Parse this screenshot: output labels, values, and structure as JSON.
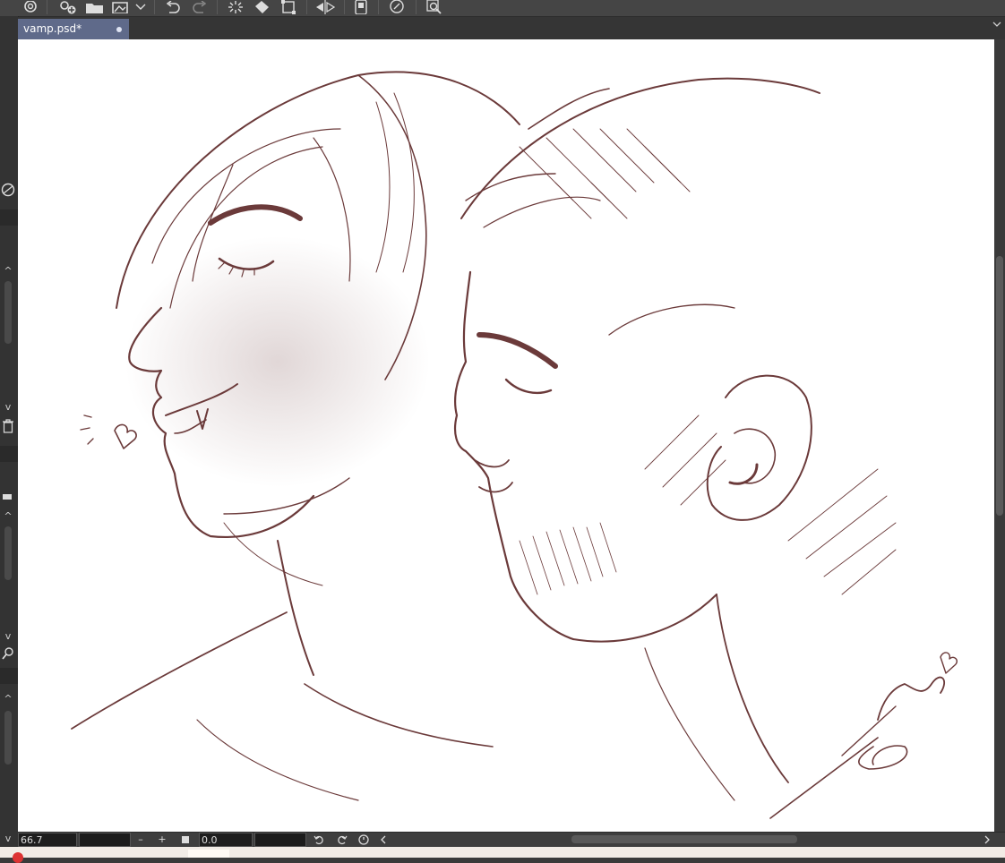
{
  "document": {
    "tab_title": "vamp.psd*"
  },
  "toolbar": {
    "icons": [
      "clip-studio-icon",
      "new-file-icon",
      "open-folder-icon",
      "save-icon",
      "undo-icon",
      "redo-icon",
      "clear-icon",
      "fill-icon",
      "transform-icon",
      "flip-icon",
      "device-icon",
      "quick-access-icon",
      "search-settings-icon"
    ]
  },
  "status": {
    "zoom": "66.7",
    "rotation": "0.0",
    "zoom_out_glyph": "–",
    "zoom_in_glyph": "+"
  },
  "colors": {
    "tab_active": "#5f6a8a",
    "ui_dark": "#3a3a3a",
    "sketch_ink": "#6b3a3a"
  }
}
